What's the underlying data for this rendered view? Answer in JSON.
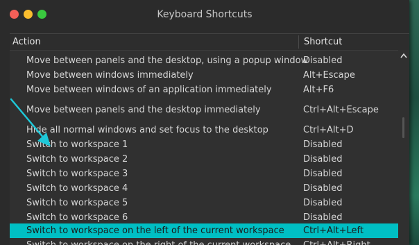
{
  "window": {
    "title": "Keyboard Shortcuts"
  },
  "columns": {
    "action": "Action",
    "shortcut": "Shortcut"
  },
  "rows": [
    {
      "action": "Move between panels and the desktop, using a popup window",
      "shortcut": "Disabled"
    },
    {
      "action": "Move between windows immediately",
      "shortcut": "Alt+Escape"
    },
    {
      "action": "Move between windows of an application immediately",
      "shortcut": "Alt+F6"
    },
    {
      "action": "Move between panels and the desktop immediately",
      "shortcut": "Ctrl+Alt+Escape"
    },
    {
      "action": "Hide all normal windows and set focus to the desktop",
      "shortcut": "Ctrl+Alt+D"
    },
    {
      "action": "Switch to workspace 1",
      "shortcut": "Disabled"
    },
    {
      "action": "Switch to workspace 2",
      "shortcut": "Disabled"
    },
    {
      "action": "Switch to workspace 3",
      "shortcut": "Disabled"
    },
    {
      "action": "Switch to workspace 4",
      "shortcut": "Disabled"
    },
    {
      "action": "Switch to workspace 5",
      "shortcut": "Disabled"
    },
    {
      "action": "Switch to workspace 6",
      "shortcut": "Disabled"
    },
    {
      "action": "Switch to workspace on the left of the current workspace",
      "shortcut": "Ctrl+Alt+Left",
      "selected": true
    },
    {
      "action": "Switch to workspace on the right of the current workspace",
      "shortcut": "Ctrl+Alt+Right"
    }
  ],
  "colors": {
    "selection": "#00bfc4",
    "annotation_arrow": "#1ec8d8",
    "close": "#f25f58",
    "minimize": "#f9bd2e",
    "maximize": "#3ac93f"
  },
  "icons": {
    "close": "close-icon",
    "minimize": "minimize-icon",
    "maximize": "maximize-icon",
    "scroll_up": "chevron-up-icon",
    "annotation": "arrow-icon"
  }
}
